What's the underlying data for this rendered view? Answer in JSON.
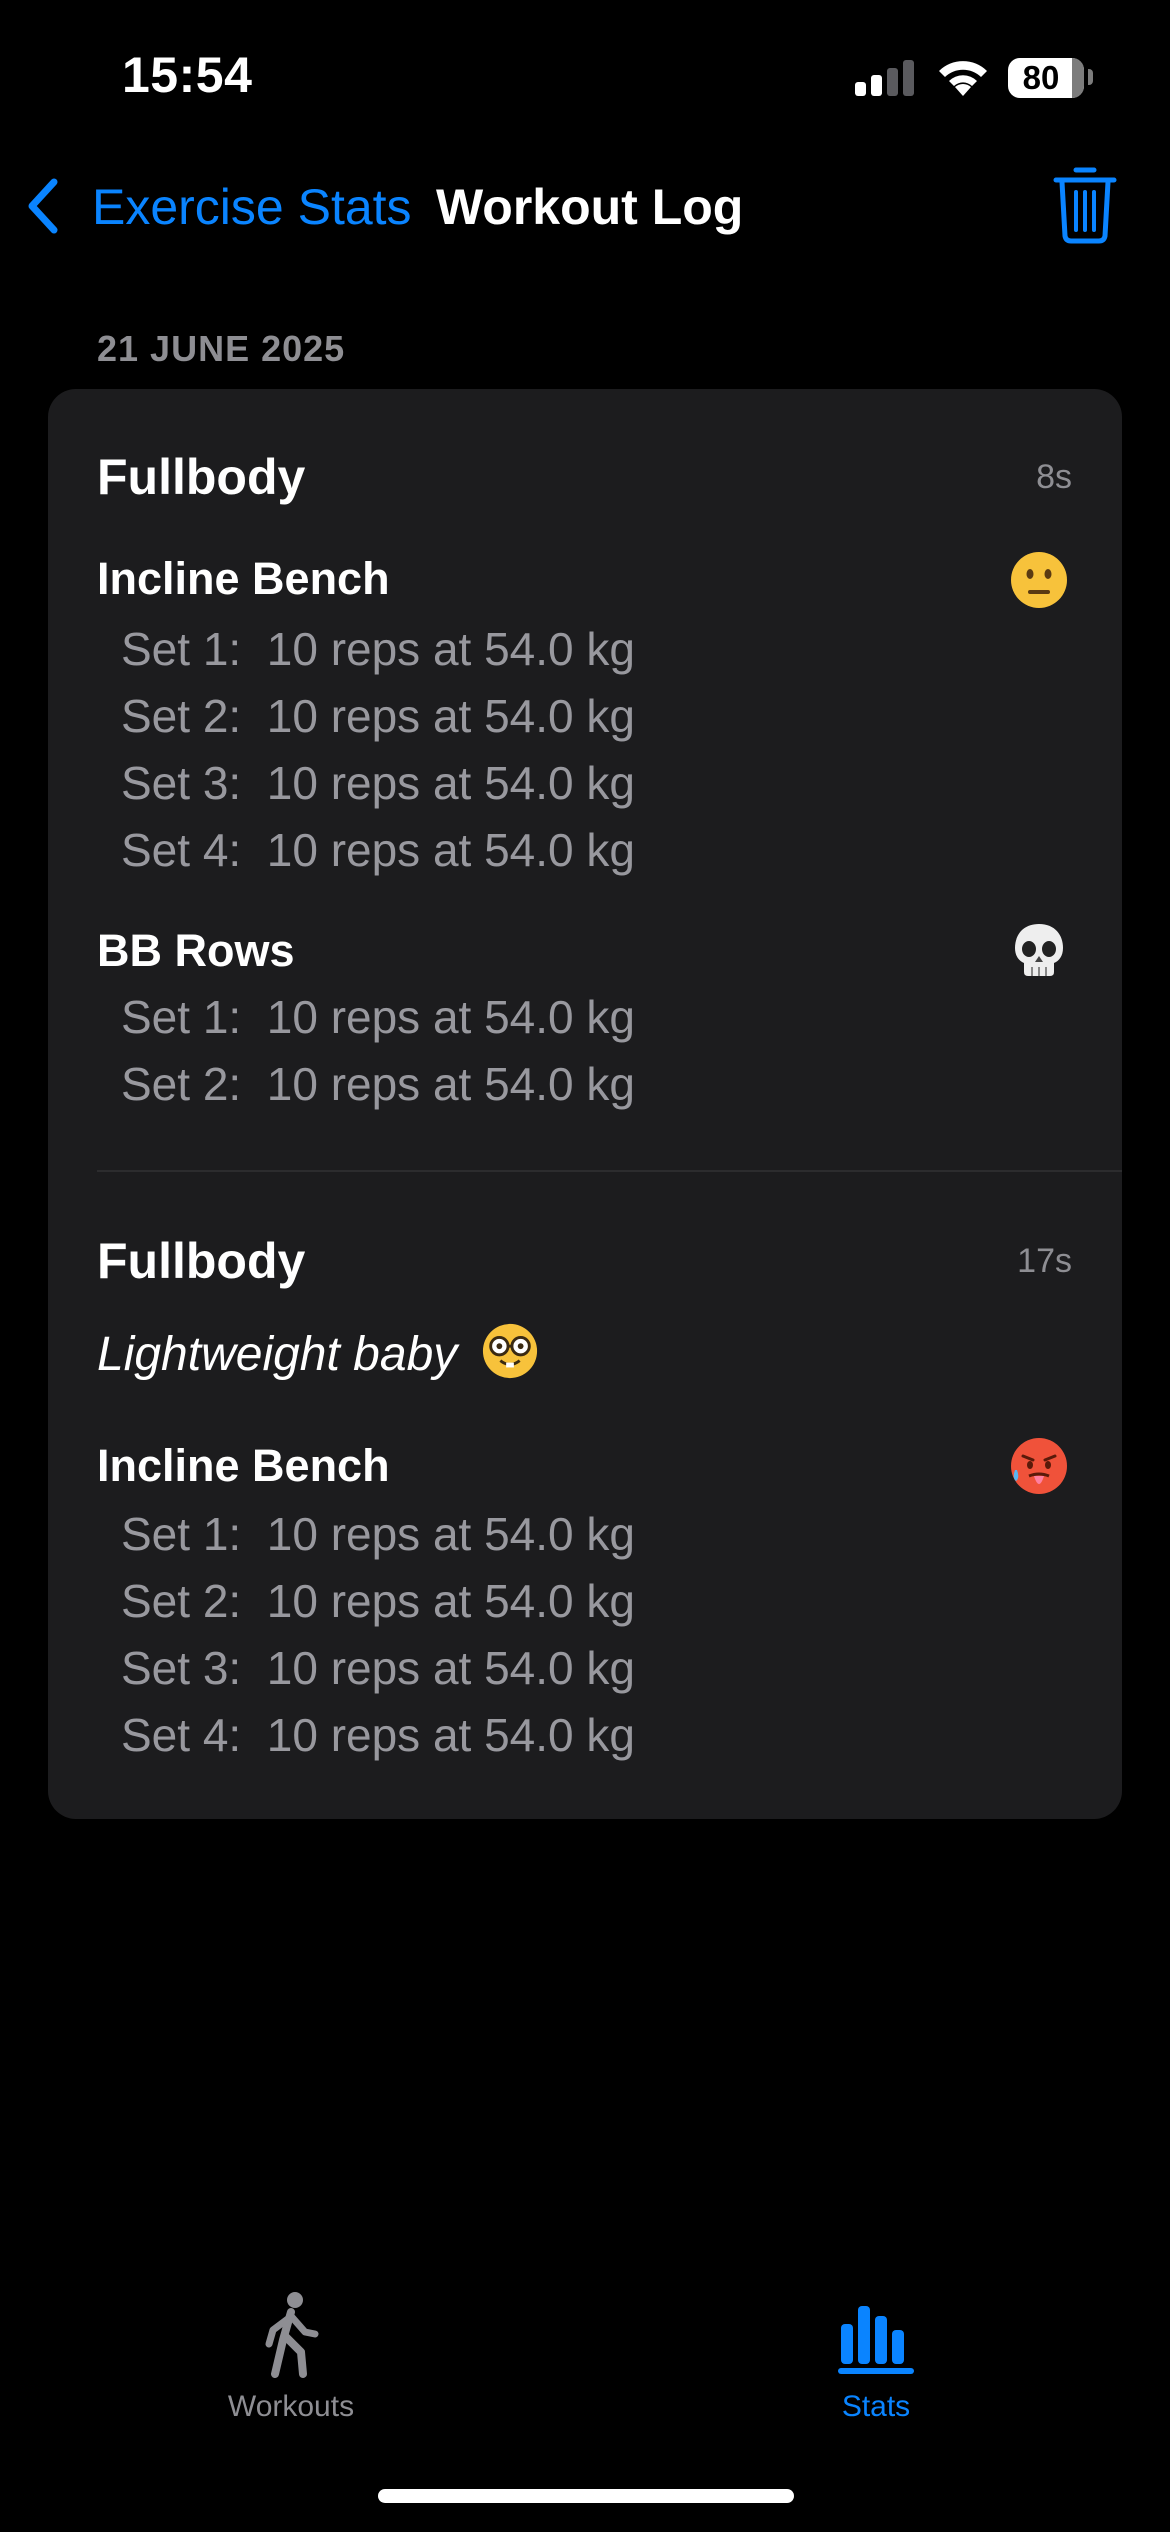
{
  "status_bar": {
    "time": "15:54",
    "battery": "80"
  },
  "nav": {
    "back_label": "Exercise Stats",
    "title": "Workout Log",
    "accent_color": "#0a84ff"
  },
  "section_date": "21 JUNE 2025",
  "workouts": [
    {
      "title": "Fullbody",
      "duration": "8s",
      "exercises": [
        {
          "name": "Incline Bench",
          "emoji": "neutral-face-icon",
          "sets": [
            "Set 1:  10 reps at 54.0 kg",
            "Set 2:  10 reps at 54.0 kg",
            "Set 3:  10 reps at 54.0 kg",
            "Set 4:  10 reps at 54.0 kg"
          ]
        },
        {
          "name": "BB Rows",
          "emoji": "skull-icon",
          "sets": [
            "Set 1:  10 reps at 54.0 kg",
            "Set 2:  10 reps at 54.0 kg"
          ]
        }
      ]
    },
    {
      "title": "Fullbody",
      "duration": "17s",
      "note": "Lightweight baby",
      "note_emoji": "nerd-face-icon",
      "exercises": [
        {
          "name": "Incline Bench",
          "emoji": "hot-face-icon",
          "sets": [
            "Set 1:  10 reps at 54.0 kg",
            "Set 2:  10 reps at 54.0 kg",
            "Set 3:  10 reps at 54.0 kg",
            "Set 4:  10 reps at 54.0 kg"
          ]
        }
      ]
    }
  ],
  "tab_bar": {
    "tabs": [
      {
        "label": "Workouts",
        "icon": "figure-walk-icon",
        "selected": false
      },
      {
        "label": "Stats",
        "icon": "bar-chart-icon",
        "selected": true
      }
    ]
  }
}
